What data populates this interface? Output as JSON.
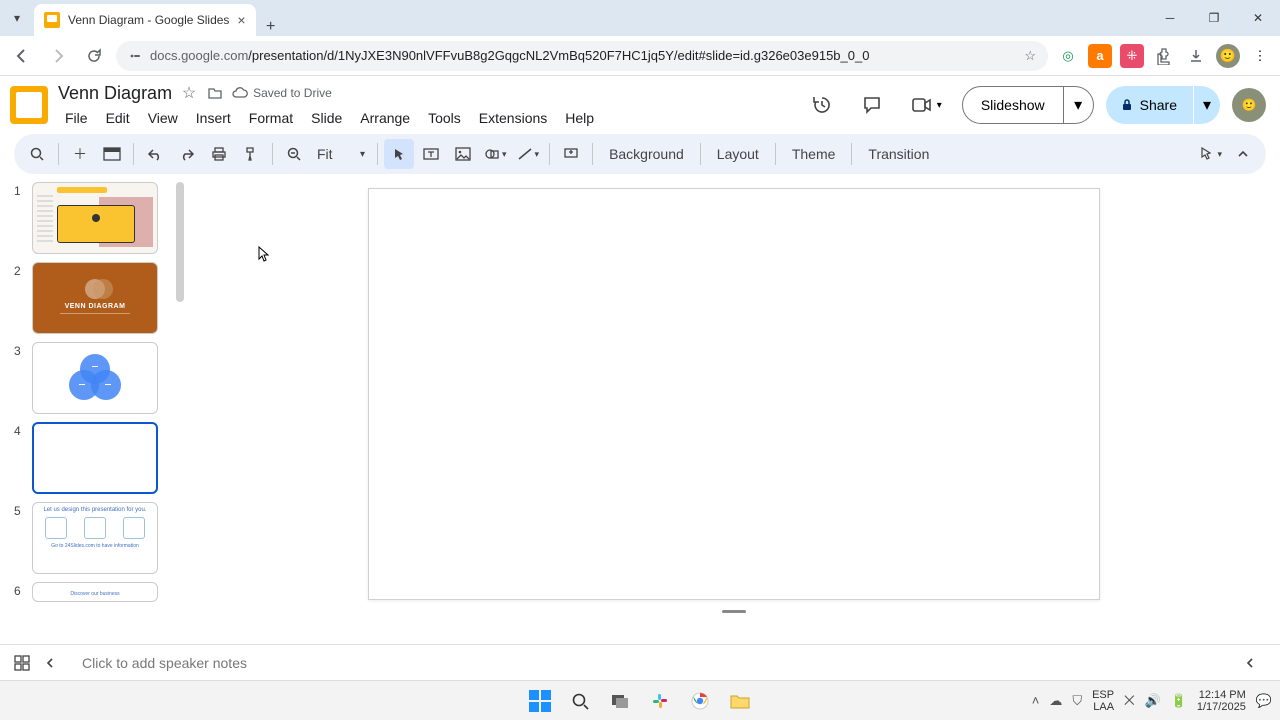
{
  "browser": {
    "tab_title": "Venn Diagram - Google Slides",
    "url_prefix": "docs.google.com",
    "url_rest": "/presentation/d/1NyJXE3N90nlVFFvuB8g2GqgcNL2VmBq520F7HC1jq5Y/edit#slide=id.g326e03e915b_0_0"
  },
  "doc": {
    "title": "Venn Diagram",
    "saved": "Saved to Drive"
  },
  "menus": {
    "file": "File",
    "edit": "Edit",
    "view": "View",
    "insert": "Insert",
    "format": "Format",
    "slide": "Slide",
    "arrange": "Arrange",
    "tools": "Tools",
    "extensions": "Extensions",
    "help": "Help"
  },
  "header": {
    "slideshow": "Slideshow",
    "share": "Share"
  },
  "toolbar": {
    "zoom": "Fit",
    "background": "Background",
    "layout": "Layout",
    "theme": "Theme",
    "transition": "Transition"
  },
  "filmstrip": {
    "n1": "1",
    "n2": "2",
    "n3": "3",
    "n4": "4",
    "n5": "5",
    "n6": "6",
    "s2_text": "VENN DIAGRAM",
    "s5_head": "Let us design this presentation for you.",
    "s5_foot": "Go to 24Slides.com to have information",
    "s6_text": "Discover our business"
  },
  "notes": {
    "placeholder": "Click to add speaker notes"
  },
  "systray": {
    "lang1": "ESP",
    "lang2": "LAA",
    "time": "12:14 PM",
    "date": "1/17/2025"
  }
}
